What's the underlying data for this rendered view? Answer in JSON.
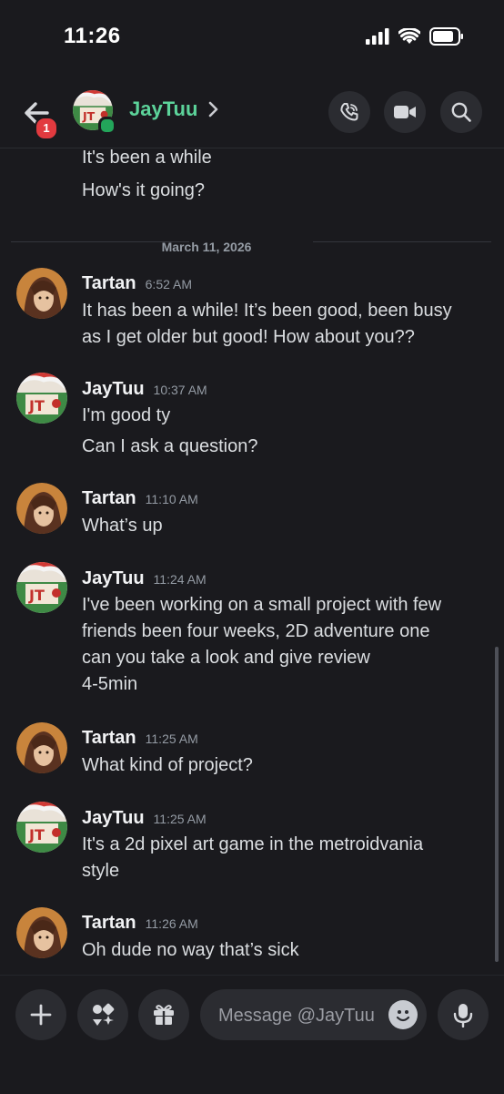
{
  "status": {
    "time": "11:26"
  },
  "header": {
    "name": "JayTuu",
    "badge_count": "1"
  },
  "partial": [
    "It's been a while",
    "How's it going?"
  ],
  "date_divider": "March 11, 2026",
  "messages": [
    {
      "author": "Tartan",
      "time": "6:52 AM",
      "lines": [
        "It has been a while! It’s been good, been busy",
        "as I get older but good! How about you??"
      ]
    },
    {
      "author": "JayTuu",
      "time": "10:37 AM",
      "lines": [
        "I'm good ty",
        "Can I ask a question?"
      ]
    },
    {
      "author": "Tartan",
      "time": "11:10 AM",
      "lines": [
        "What’s up"
      ]
    },
    {
      "author": "JayTuu",
      "time": "11:24 AM",
      "lines": [
        "I've been working on a small project with few",
        "friends been four weeks, 2D adventure one",
        "can you take a look and give review",
        "4-5min"
      ]
    },
    {
      "author": "Tartan",
      "time": "11:25 AM",
      "lines": [
        "What kind of project?"
      ]
    },
    {
      "author": "JayTuu",
      "time": "11:25 AM",
      "lines": [
        "It's a 2d pixel art game in the metroidvania",
        "style"
      ]
    },
    {
      "author": "Tartan",
      "time": "11:26 AM",
      "lines": [
        "Oh dude no way that’s sick"
      ]
    }
  ],
  "composer": {
    "placeholder": "Message @JayTuu"
  },
  "colors": {
    "accent_name": "#5cd39a",
    "online": "#23a55a",
    "badge": "#e23a3f",
    "background": "#1a1a1e"
  },
  "icons": [
    "back-arrow-icon",
    "phone-icon",
    "video-camera-icon",
    "search-icon",
    "plus-icon",
    "apps-icon",
    "gift-icon",
    "emoji-icon",
    "microphone-icon"
  ]
}
